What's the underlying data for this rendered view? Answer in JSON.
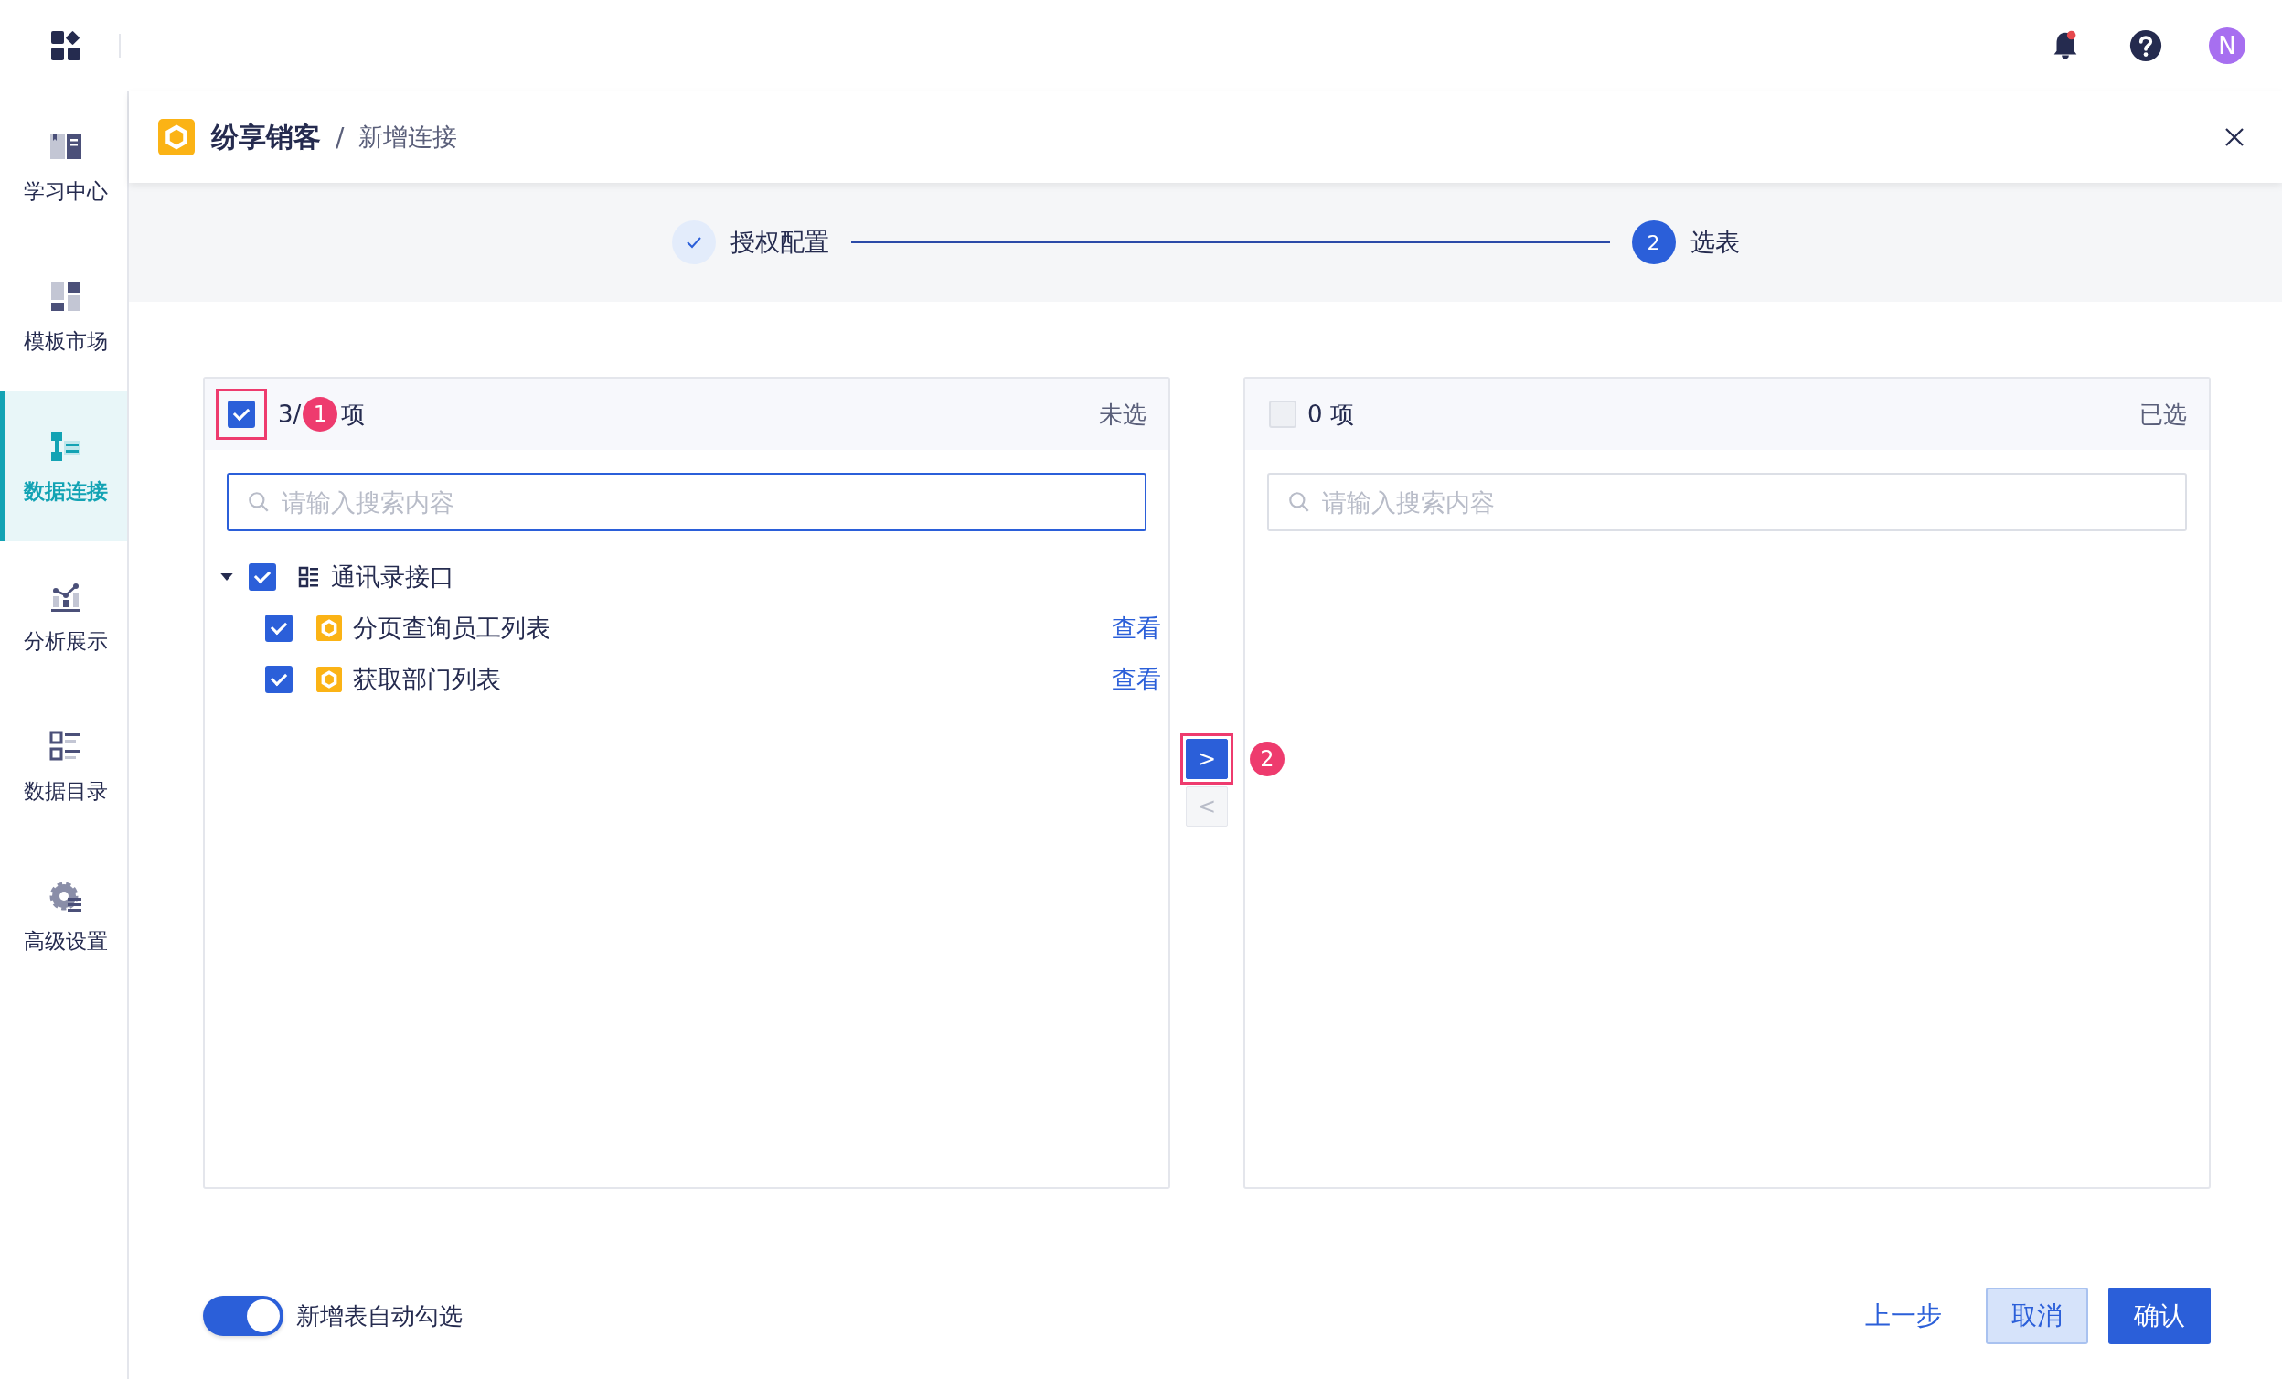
{
  "topbar": {
    "avatar": "N",
    "notification_dot": true
  },
  "sidebar": {
    "items": [
      {
        "label": "学习中心",
        "kind": "book",
        "selected": false
      },
      {
        "label": "模板市场",
        "kind": "template",
        "selected": false
      },
      {
        "label": "数据连接",
        "kind": "connect",
        "selected": true
      },
      {
        "label": "分析展示",
        "kind": "chart",
        "selected": false
      },
      {
        "label": "数据目录",
        "kind": "catalog",
        "selected": false
      },
      {
        "label": "高级设置",
        "kind": "gear",
        "selected": false
      }
    ]
  },
  "dialog": {
    "app_name": "纷享销客",
    "separator": "/",
    "title": "新增连接"
  },
  "steps": [
    {
      "label": "授权配置",
      "completed": true
    },
    {
      "number": "2",
      "label": "选表",
      "completed": false
    }
  ],
  "source_panel": {
    "all_checked": true,
    "count_prefix": "3/",
    "count_suffix": "项",
    "header_label": "未选",
    "search_placeholder": "请输入搜索内容",
    "tree": [
      {
        "label": "通讯录接口",
        "checked": true,
        "expanded": true,
        "children": [
          {
            "label": "分页查询员工列表",
            "checked": true,
            "action": "查看"
          },
          {
            "label": "获取部门列表",
            "checked": true,
            "action": "查看"
          }
        ]
      }
    ]
  },
  "transfer_buttons": [
    {
      "symbol": ">",
      "disabled": false
    },
    {
      "symbol": "<",
      "disabled": true
    }
  ],
  "target_panel": {
    "all_checked": false,
    "count": "0 项",
    "header_label": "已选",
    "search_placeholder": "请输入搜索内容"
  },
  "annotations": [
    {
      "number": "1"
    },
    {
      "number": "2"
    }
  ],
  "auto_select_toggle": {
    "on": true,
    "label": "新增表自动勾选"
  },
  "footer_buttons": [
    {
      "label": "上一步",
      "kind": "link"
    },
    {
      "label": "取消",
      "kind": "secondary"
    },
    {
      "label": "确认",
      "kind": "primary"
    }
  ]
}
